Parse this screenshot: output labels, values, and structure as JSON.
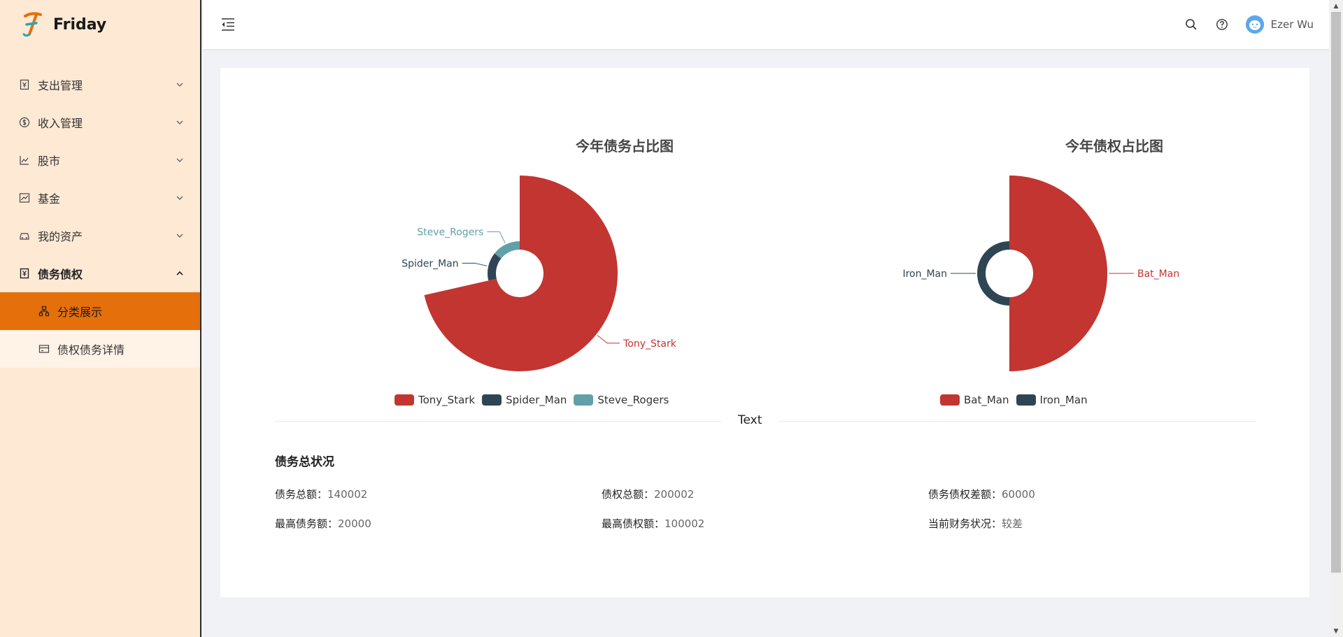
{
  "app": {
    "name": "Friday"
  },
  "sidebar": {
    "items": [
      {
        "label": "支出管理",
        "icon": "receipt-icon"
      },
      {
        "label": "收入管理",
        "icon": "dollar-circle-icon"
      },
      {
        "label": "股市",
        "icon": "line-chart-icon"
      },
      {
        "label": "基金",
        "icon": "area-chart-icon"
      },
      {
        "label": "我的资产",
        "icon": "car-icon"
      },
      {
        "label": "债务债权",
        "icon": "account-book-icon"
      }
    ],
    "subitems": [
      {
        "label": "分类展示",
        "icon": "cluster-icon",
        "active": true
      },
      {
        "label": "债权债务详情",
        "icon": "credit-card-icon",
        "active": false
      }
    ]
  },
  "header": {
    "username": "Ezer Wu"
  },
  "main": {
    "divider_text": "Text",
    "summary_title": "债务总状况",
    "summary": [
      {
        "label": "债务总额：",
        "value": "140002"
      },
      {
        "label": "债权总额：",
        "value": "200002"
      },
      {
        "label": "债务债权差额：",
        "value": "60000"
      },
      {
        "label": "最高债务额：",
        "value": "20000"
      },
      {
        "label": "最高债权额：",
        "value": "100002"
      },
      {
        "label": "当前财务状况：",
        "value": "较差"
      }
    ]
  },
  "chart_data": [
    {
      "type": "pie",
      "title": "今年债务占比图",
      "rose": true,
      "categories": [
        "Tony_Stark",
        "Spider_Man",
        "Steve_Rogers"
      ],
      "values": [
        100000,
        20000,
        20002
      ],
      "colors": [
        "#c23531",
        "#2f4554",
        "#61a0a8"
      ]
    },
    {
      "type": "pie",
      "title": "今年债权占比图",
      "rose": true,
      "categories": [
        "Bat_Man",
        "Iron_Man"
      ],
      "values": [
        100002,
        100000
      ],
      "colors": [
        "#c23531",
        "#2f4554"
      ]
    }
  ]
}
